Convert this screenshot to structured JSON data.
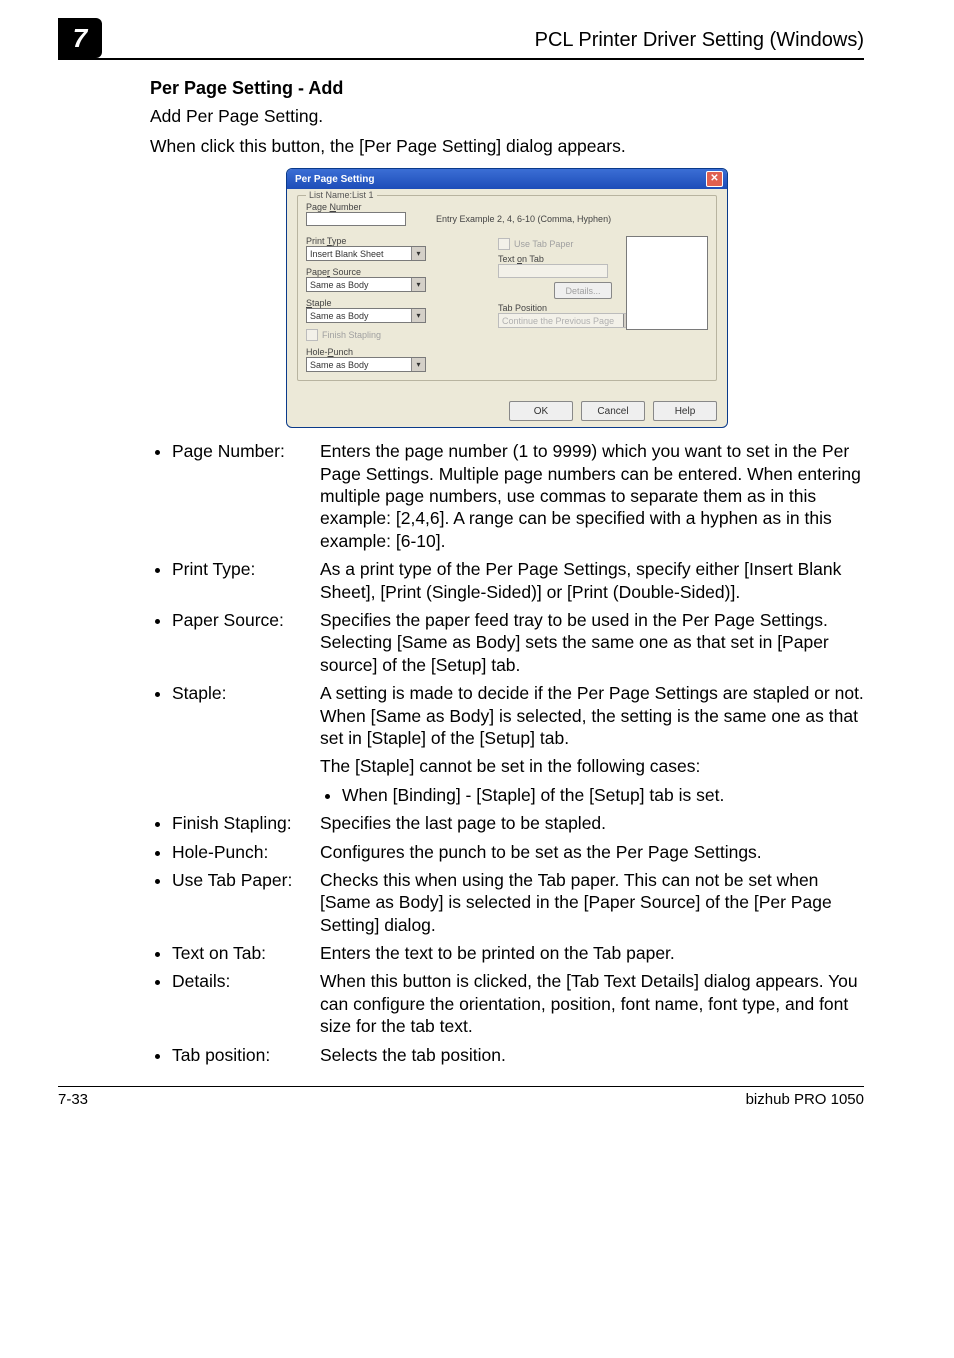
{
  "chapter_number": "7",
  "header_title": "PCL Printer Driver Setting (Windows)",
  "section": {
    "heading": "Per Page Setting - Add",
    "intro_line1": "Add Per Page Setting.",
    "intro_line2": "When click this button, the [Per Page Setting] dialog appears."
  },
  "dialog": {
    "title": "Per Page Setting",
    "close_glyph": "✕",
    "group_legend": "List Name:List 1",
    "page_number_label_pre": "Page ",
    "page_number_underline": "N",
    "page_number_label_post": "umber",
    "page_number_hint": "Entry Example 2, 4, 6-10 (Comma, Hyphen)",
    "print_type_label_pre": "Print ",
    "print_type_underline": "T",
    "print_type_label_post": "ype",
    "print_type_value": "Insert Blank Sheet",
    "paper_source_label_pre": "Pape",
    "paper_source_underline": "r",
    "paper_source_label_post": " Source",
    "paper_source_value": "Same as Body",
    "staple_label": "Staple",
    "staple_value": "Same as Body",
    "finish_stapling_pre": "",
    "finish_stapling_underline": "F",
    "finish_stapling_post": "inish Stapling",
    "hole_punch_label_pre": "Hole-",
    "hole_punch_underline": "P",
    "hole_punch_label_post": "unch",
    "hole_punch_value": "Same as Body",
    "use_tab_paper_pre": "",
    "use_tab_paper_underline": "U",
    "use_tab_paper_post": "se Tab Paper",
    "text_on_tab_pre": "Text ",
    "text_on_tab_underline": "o",
    "text_on_tab_post": "n Tab",
    "details_underline": "D",
    "details_post": "etails...",
    "tab_position_label": "Tab Position",
    "tab_position_value": "Continue the Previous Page",
    "ok": "OK",
    "cancel": "Cancel",
    "help": "Help"
  },
  "defs": [
    {
      "term": "Page Number:",
      "desc": "Enters the page number (1 to 9999) which you want to set in the Per Page Settings. Multiple page numbers can be entered. When entering multiple page numbers, use commas to separate them as in this example: [2,4,6]. A range can be specified with a hyphen as in this example: [6-10]."
    },
    {
      "term": "Print Type:",
      "desc": "As a print type of the Per Page Settings, specify either [Insert Blank Sheet], [Print (Single-Sided)] or [Print (Double-Sided)]."
    },
    {
      "term": "Paper Source:",
      "desc": "Specifies the paper feed tray to be used in the Per Page Settings. Selecting [Same as Body] sets the same one as that set in [Paper source] of the [Setup] tab."
    },
    {
      "term": "Staple:",
      "desc": "A setting is made to decide if the Per Page Settings are stapled or not. When [Same as Body] is selected, the setting is the same one as that set in [Staple] of the [Setup] tab.",
      "extra": "The [Staple] cannot be set in the following cases:",
      "sub": [
        "When [Binding] - [Staple] of the [Setup] tab is set."
      ]
    },
    {
      "term": "Finish Stapling:",
      "desc": "Specifies the last page to be stapled."
    },
    {
      "term": "Hole-Punch:",
      "desc": "Configures the punch to be set as the Per Page Settings."
    },
    {
      "term": "Use Tab Paper:",
      "desc": "Checks this when using the Tab paper. This can not be set when [Same as Body] is selected in the [Paper Source] of the [Per Page Setting] dialog."
    },
    {
      "term": "Text on Tab:",
      "desc": "Enters the text to be printed on the Tab paper."
    },
    {
      "term": "Details:",
      "desc": "When this button is clicked, the [Tab Text Details] dialog appears. You can configure the orientation, position, font name, font type, and font size for the tab text."
    },
    {
      "term": "Tab position:",
      "desc": "Selects the tab position."
    }
  ],
  "footer": {
    "page_num": "7-33",
    "product": "bizhub PRO 1050"
  }
}
